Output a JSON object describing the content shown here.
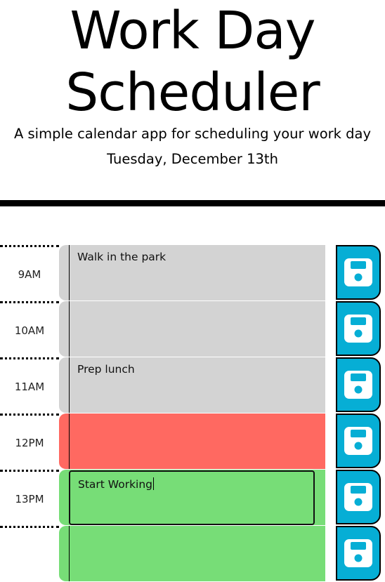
{
  "header": {
    "title_line1": "Work Day",
    "title_line2": "Scheduler",
    "subtitle": "A simple calendar app for scheduling your work day",
    "current_day": "Tuesday, December 13th"
  },
  "colors": {
    "past": "#d3d3d3",
    "present": "#ff6961",
    "future": "#77dd77",
    "save_button": "#06aed5"
  },
  "time_blocks": [
    {
      "hour_label": "9AM",
      "text": "Walk in the park",
      "state": "past",
      "save_icon": "floppy-disk-icon"
    },
    {
      "hour_label": "10AM",
      "text": "",
      "state": "past",
      "save_icon": "floppy-disk-icon"
    },
    {
      "hour_label": "11AM",
      "text": "Prep lunch",
      "state": "past",
      "save_icon": "floppy-disk-icon"
    },
    {
      "hour_label": "12PM",
      "text": "",
      "state": "present",
      "save_icon": "floppy-disk-icon"
    },
    {
      "hour_label": "13PM",
      "text": "Start Working",
      "state": "future",
      "focused": true,
      "save_icon": "floppy-disk-icon"
    },
    {
      "hour_label": "",
      "text": "",
      "state": "future",
      "save_icon": "floppy-disk-icon"
    }
  ]
}
